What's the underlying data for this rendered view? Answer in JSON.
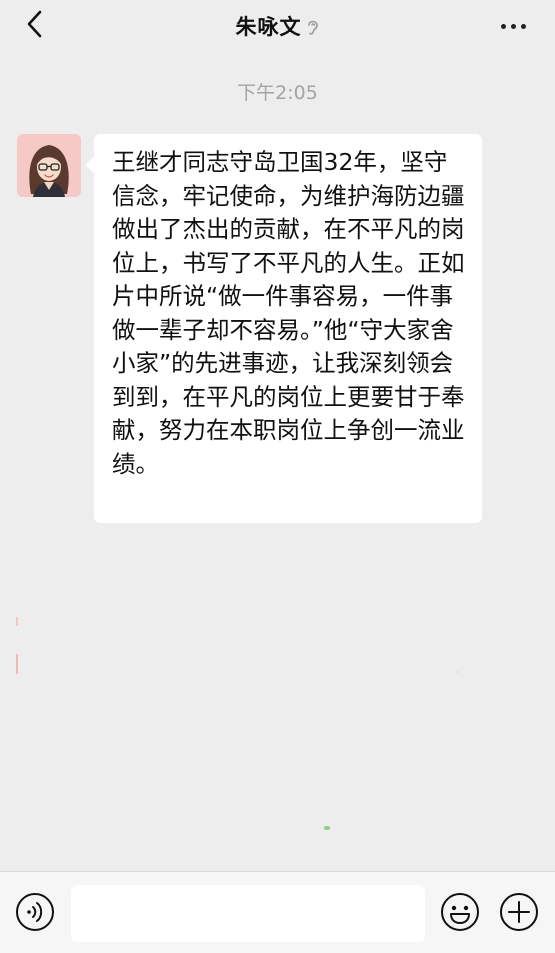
{
  "header": {
    "title": "朱咏文",
    "back_icon": "chevron-left-icon",
    "ear_icon": "ear-icon",
    "more_icon": "more-dots-icon"
  },
  "chat": {
    "timestamp": "下午2:05",
    "message": {
      "avatar_icon": "avatar-woman-glasses",
      "text": "王继才同志守岛卫国32年，坚守信念，牢记使命，为维护海防边疆做出了杰出的贡献，在不平凡的岗位上，书写了不平凡的人生。正如片中所说“做一件事容易，一件事做一辈子却不容易。”他“守大家舍小家”的先进事迹，让我深刻领会到到，在平凡的岗位上更要甘于奉献，努力在本职岗位上争创一流业绩。"
    }
  },
  "input_bar": {
    "voice_icon": "voice-icon",
    "input_value": "",
    "emoji_icon": "emoji-icon",
    "plus_icon": "plus-icon"
  },
  "colors": {
    "background": "#ededed",
    "bubble": "#ffffff",
    "timestamp": "#a3a3a3",
    "text": "#111111"
  }
}
